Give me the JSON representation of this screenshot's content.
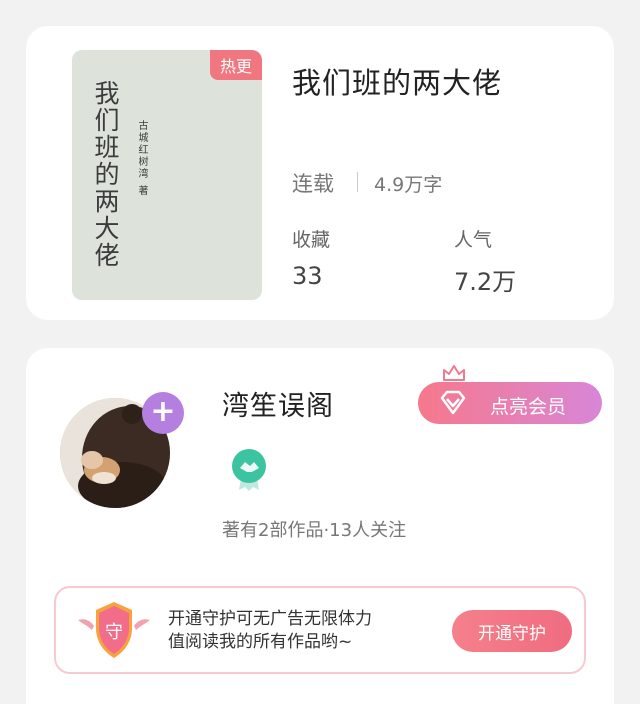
{
  "book": {
    "cover_title": "我们班的两大佬",
    "cover_author": "古城红树湾 著",
    "hot_badge": "热更",
    "title": "我们班的两大佬",
    "status": "连载",
    "word_count": "4.9万字",
    "stats": {
      "favorites_label": "收藏",
      "favorites_value": "33",
      "popularity_label": "人气",
      "popularity_value": "7.2万"
    }
  },
  "author": {
    "name": "湾笙误阁",
    "meta": "著有2部作品·13人关注",
    "follow_icon": "plus-icon",
    "vip_button": "点亮会员"
  },
  "guard": {
    "shield_text": "守",
    "line1": "开通守护可无广告无限体力",
    "line2": "值阅读我的所有作品哟~",
    "button": "开通守护"
  },
  "colors": {
    "hot_badge": "#f0777f",
    "follow": "#b57fe0",
    "vip_start": "#f6788b",
    "vip_end": "#d886d8",
    "medal": "#3cc4a0",
    "guard_border": "#f7c9d1"
  }
}
